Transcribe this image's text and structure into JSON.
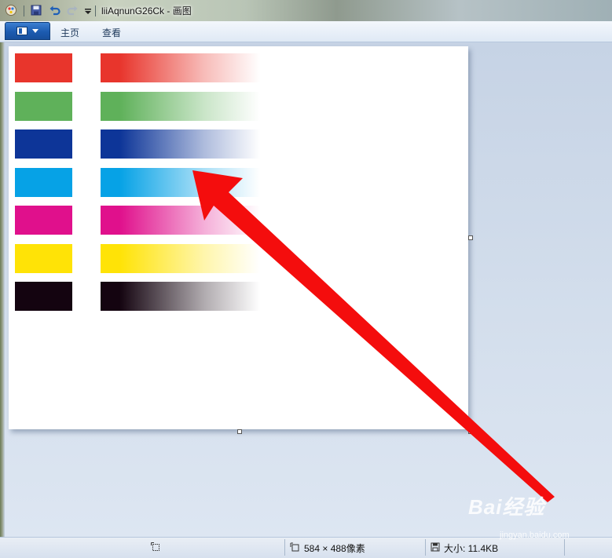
{
  "window": {
    "title": "liiAqnunG26Ck - 画图"
  },
  "ribbon": {
    "tabs": [
      {
        "label": "主页"
      },
      {
        "label": "查看"
      }
    ]
  },
  "canvas": {
    "colors": [
      {
        "name": "red",
        "hex": "#e8352c"
      },
      {
        "name": "green",
        "hex": "#5fb15a"
      },
      {
        "name": "dark-blue",
        "hex": "#0d3598"
      },
      {
        "name": "cyan",
        "hex": "#06a2e6"
      },
      {
        "name": "magenta",
        "hex": "#e0108c"
      },
      {
        "name": "yellow",
        "hex": "#ffe306"
      },
      {
        "name": "black",
        "hex": "#140410"
      }
    ],
    "annotation_arrow_color": "#f40d0d"
  },
  "statusbar": {
    "dimensions": "584 × 488像素",
    "size": "大小: 11.4KB"
  },
  "watermark": {
    "brand": "Bai经验",
    "url": "jingyan.baidu.com"
  }
}
